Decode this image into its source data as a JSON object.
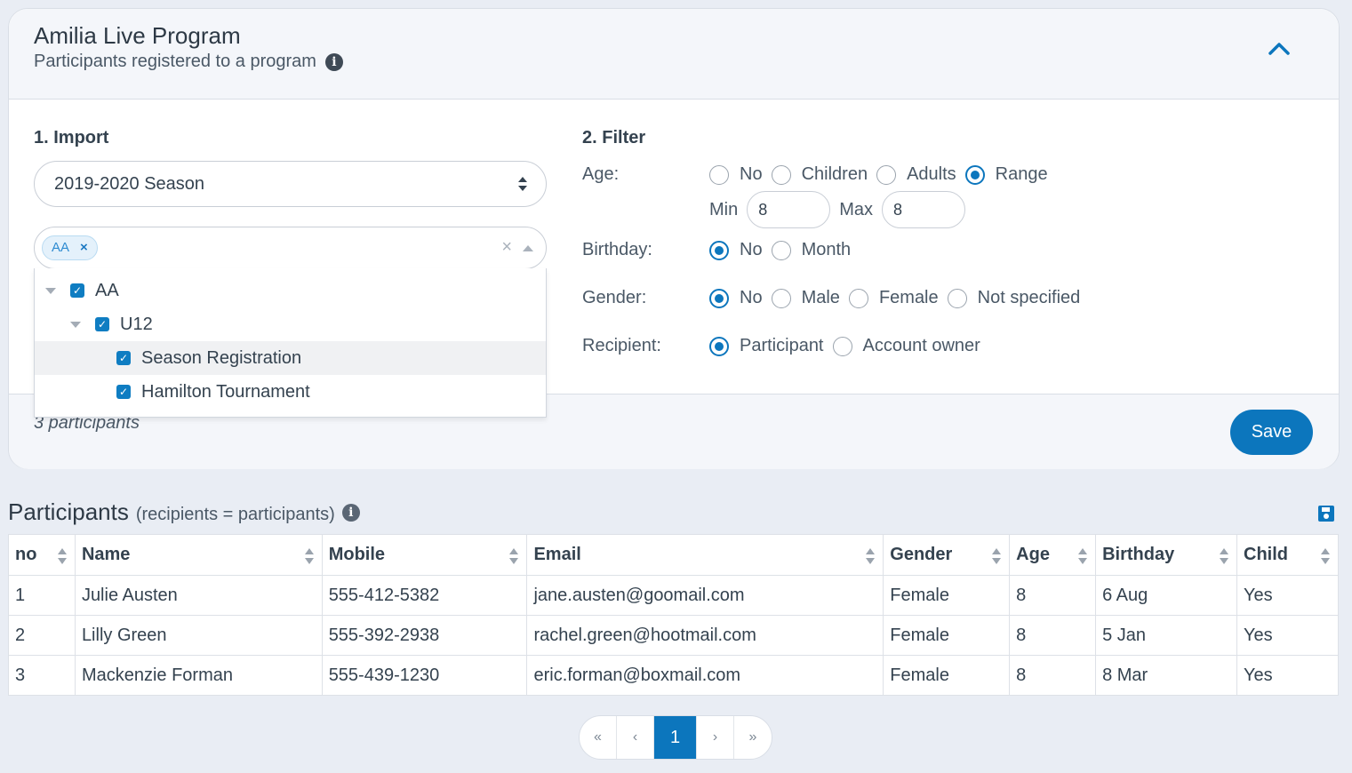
{
  "program": {
    "title": "Amilia Live Program",
    "subtitle": "Participants registered to a program"
  },
  "import": {
    "heading": "1. Import",
    "season": "2019-2020 Season",
    "tag": "AA",
    "tag_remove": "×",
    "clear": "×",
    "tree": [
      {
        "label": "AA",
        "checked": true
      },
      {
        "label": "U12",
        "checked": true
      },
      {
        "label": "Season Registration",
        "checked": true
      },
      {
        "label": "Hamilton Tournament",
        "checked": true
      }
    ],
    "count": "3 participants"
  },
  "filter": {
    "heading": "2. Filter",
    "age": {
      "label": "Age:",
      "options": [
        "No",
        "Children",
        "Adults",
        "Range"
      ],
      "selected": "Range",
      "min_label": "Min",
      "min": "8",
      "max_label": "Max",
      "max": "8"
    },
    "birthday": {
      "label": "Birthday:",
      "options": [
        "No",
        "Month"
      ],
      "selected": "No"
    },
    "gender": {
      "label": "Gender:",
      "options": [
        "No",
        "Male",
        "Female",
        "Not specified"
      ],
      "selected": "No"
    },
    "recipient": {
      "label": "Recipient:",
      "options": [
        "Participant",
        "Account owner"
      ],
      "selected": "Participant"
    }
  },
  "save_label": "Save",
  "participants": {
    "title": "Participants",
    "subtitle": "(recipients = participants)",
    "columns": [
      "no",
      "Name",
      "Mobile",
      "Email",
      "Gender",
      "Age",
      "Birthday",
      "Child"
    ],
    "rows": [
      [
        "1",
        "Julie Austen",
        "555-412-5382",
        "jane.austen@goomail.com",
        "Female",
        "8",
        "6 Aug",
        "Yes"
      ],
      [
        "2",
        "Lilly Green",
        "555-392-2938",
        "rachel.green@hootmail.com",
        "Female",
        "8",
        "5 Jan",
        "Yes"
      ],
      [
        "3",
        "Mackenzie Forman",
        "555-439-1230",
        "eric.forman@boxmail.com",
        "Female",
        "8",
        "8 Mar",
        "Yes"
      ]
    ]
  },
  "pagination": {
    "first": "«",
    "prev": "‹",
    "current": "1",
    "next": "›",
    "last": "»"
  },
  "colors": {
    "accent": "#0c76bd",
    "background": "#e9edf4"
  }
}
